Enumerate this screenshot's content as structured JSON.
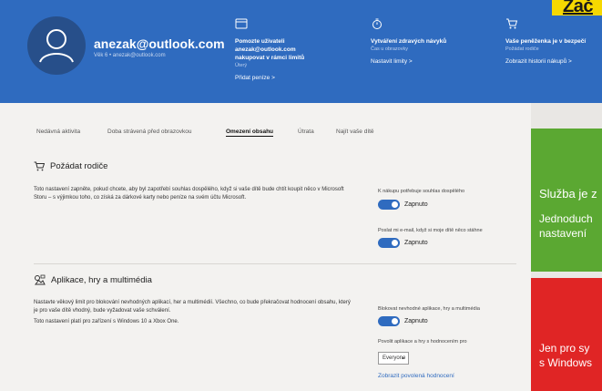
{
  "badge": {
    "text": "Zač"
  },
  "header": {
    "email": "anezak@outlook.com",
    "sub": "Věk 6 • anezak@outlook.com",
    "cols": [
      {
        "icon": "card-icon",
        "main": "Pomozte uživateli anezak@outlook.com nakupovat v rámci limitů",
        "sub": "Úterý",
        "link": "Přidat peníze >"
      },
      {
        "icon": "timer-icon",
        "main": "Vytváření zdravých návyků",
        "sub": "Čas u obrazovky",
        "link": "Nastavit limity >"
      },
      {
        "icon": "cart-icon",
        "main": "Vaše peněženka je v bezpečí",
        "sub": "Požádat rodiče",
        "link": "Zobrazit historii nákupů >"
      }
    ]
  },
  "tabs": [
    "Nedávná aktivita",
    "Doba strávená před obrazovkou",
    "Omezení obsahu",
    "Útrata",
    "Najít vaše dítě"
  ],
  "sections": {
    "ask": {
      "title": "Požádat rodiče",
      "desc": "Toto nastavení zapněte, pokud chcete, aby byl zapotřebí souhlas dospělého, když si vaše dítě bude chtít koupit něco v Microsoft Storu – s výjimkou toho, co získá za dárkové karty nebo peníze na svém účtu Microsoft.",
      "opt1_label": "K nákupu potřebuje souhlas dospělého",
      "opt1_state": "Zapnuto",
      "opt2_label": "Poslat mi e-mail, když si moje dítě něco stáhne",
      "opt2_state": "Zapnuto"
    },
    "apps": {
      "title": "Aplikace, hry a multimédia",
      "desc1": "Nastavte věkový limit pro blokování nevhodných aplikací, her a multimédií. Všechno, co bude překračovat hodnocení obsahu, který je pro vaše dítě vhodný, bude vyžadovat vaše schválení.",
      "desc2": "Toto nastavení platí pro zařízení s Windows 10 a Xbox One.",
      "opt1_label": "Blokovat nevhodné aplikace, hry a multimédia",
      "opt1_state": "Zapnuto",
      "opt2_label": "Povolit aplikace a hry s hodnocením pro",
      "select_value": "Everyone",
      "link": "Zobrazit povolená hodnocení"
    }
  },
  "tiles": {
    "green_line1": "Služba je z",
    "green_line2": "Jednoduch",
    "green_line3": "nastavení",
    "red_line1": "Jen pro sy",
    "red_line2": "s Windows"
  },
  "colors": {
    "header_blue": "#2f6bbf",
    "green": "#5ba832",
    "red": "#e02525",
    "yellow": "#f6d800"
  }
}
